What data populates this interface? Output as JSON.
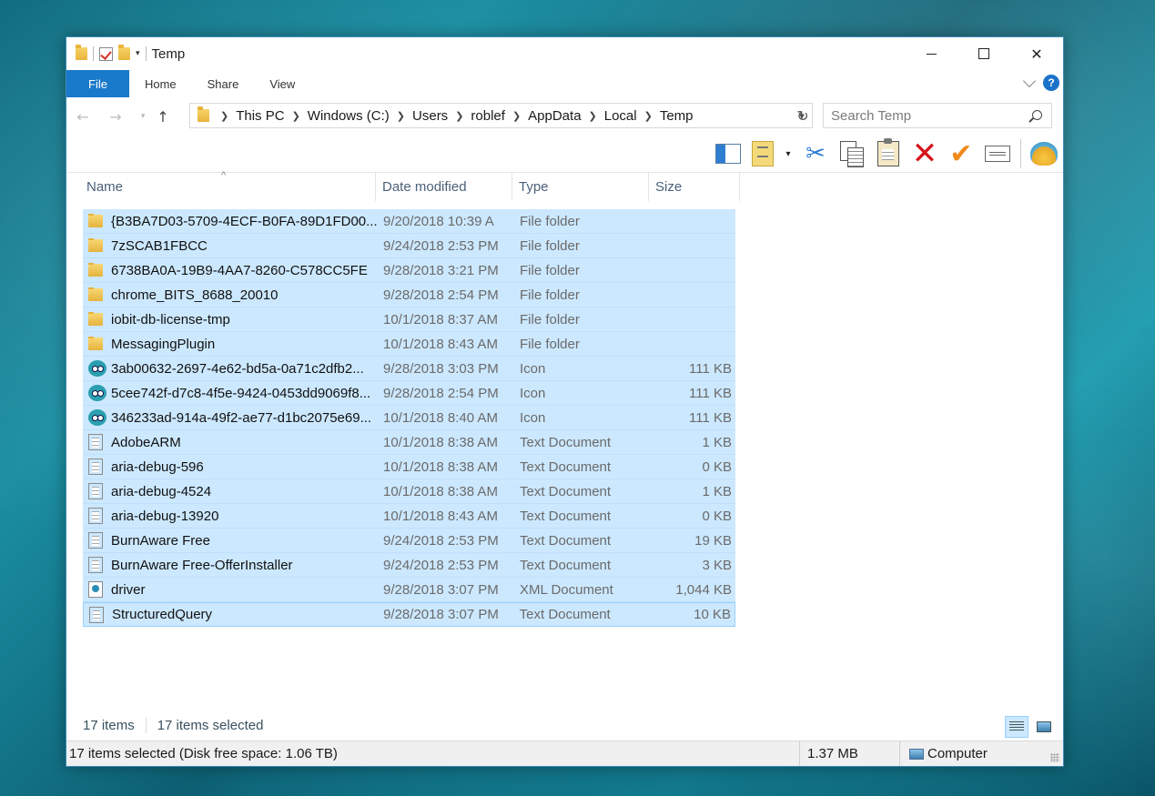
{
  "window": {
    "title": "Temp"
  },
  "ribbon": {
    "tabs": [
      {
        "label": "File"
      },
      {
        "label": "Home"
      },
      {
        "label": "Share"
      },
      {
        "label": "View"
      }
    ],
    "help": "?"
  },
  "address": {
    "crumbs": [
      "This PC",
      "Windows (C:)",
      "Users",
      "roblef",
      "AppData",
      "Local",
      "Temp"
    ]
  },
  "search": {
    "placeholder": "Search Temp"
  },
  "columns": {
    "name": "Name",
    "date": "Date modified",
    "type": "Type",
    "size": "Size"
  },
  "files": [
    {
      "icon": "folder-icon",
      "name": "{B3BA7D03-5709-4ECF-B0FA-89D1FD00...",
      "date": "9/20/2018 10:39 A",
      "type": "File folder",
      "size": ""
    },
    {
      "icon": "folder-icon",
      "name": "7zSCAB1FBCC",
      "date": "9/24/2018 2:53 PM",
      "type": "File folder",
      "size": ""
    },
    {
      "icon": "folder-icon",
      "name": "6738BA0A-19B9-4AA7-8260-C578CC5FE",
      "date": "9/28/2018 3:21 PM",
      "type": "File folder",
      "size": ""
    },
    {
      "icon": "folder-icon",
      "name": "chrome_BITS_8688_20010",
      "date": "9/28/2018 2:54 PM",
      "type": "File folder",
      "size": ""
    },
    {
      "icon": "folder-icon",
      "name": "iobit-db-license-tmp",
      "date": "10/1/2018 8:37 AM",
      "type": "File folder",
      "size": ""
    },
    {
      "icon": "folder-icon",
      "name": "MessagingPlugin",
      "date": "10/1/2018 8:43 AM",
      "type": "File folder",
      "size": ""
    },
    {
      "icon": "app-icon",
      "name": "3ab00632-2697-4e62-bd5a-0a71c2dfb2...",
      "date": "9/28/2018 3:03 PM",
      "type": "Icon",
      "size": "111 KB"
    },
    {
      "icon": "app-icon",
      "name": "5cee742f-d7c8-4f5e-9424-0453dd9069f8...",
      "date": "9/28/2018 2:54 PM",
      "type": "Icon",
      "size": "111 KB"
    },
    {
      "icon": "app-icon",
      "name": "346233ad-914a-49f2-ae77-d1bc2075e69...",
      "date": "10/1/2018 8:40 AM",
      "type": "Icon",
      "size": "111 KB"
    },
    {
      "icon": "document-icon",
      "name": "AdobeARM",
      "date": "10/1/2018 8:38 AM",
      "type": "Text Document",
      "size": "1 KB"
    },
    {
      "icon": "document-icon",
      "name": "aria-debug-596",
      "date": "10/1/2018 8:38 AM",
      "type": "Text Document",
      "size": "0 KB"
    },
    {
      "icon": "document-icon",
      "name": "aria-debug-4524",
      "date": "10/1/2018 8:38 AM",
      "type": "Text Document",
      "size": "1 KB"
    },
    {
      "icon": "document-icon",
      "name": "aria-debug-13920",
      "date": "10/1/2018 8:43 AM",
      "type": "Text Document",
      "size": "0 KB"
    },
    {
      "icon": "document-icon",
      "name": "BurnAware Free",
      "date": "9/24/2018 2:53 PM",
      "type": "Text Document",
      "size": "19 KB"
    },
    {
      "icon": "document-icon",
      "name": "BurnAware Free-OfferInstaller",
      "date": "9/24/2018 2:53 PM",
      "type": "Text Document",
      "size": "3 KB"
    },
    {
      "icon": "xml-icon",
      "name": "driver",
      "date": "9/28/2018 3:07 PM",
      "type": "XML Document",
      "size": "1,044 KB"
    },
    {
      "icon": "document-icon",
      "name": "StructuredQuery",
      "date": "9/28/2018 3:07 PM",
      "type": "Text Document",
      "size": "10 KB"
    }
  ],
  "info": {
    "count": "17 items",
    "selected": "17 items selected"
  },
  "statusbar": {
    "selection": "17 items selected (Disk free space: 1.06 TB)",
    "size": "1.37 MB",
    "location": "Computer"
  }
}
